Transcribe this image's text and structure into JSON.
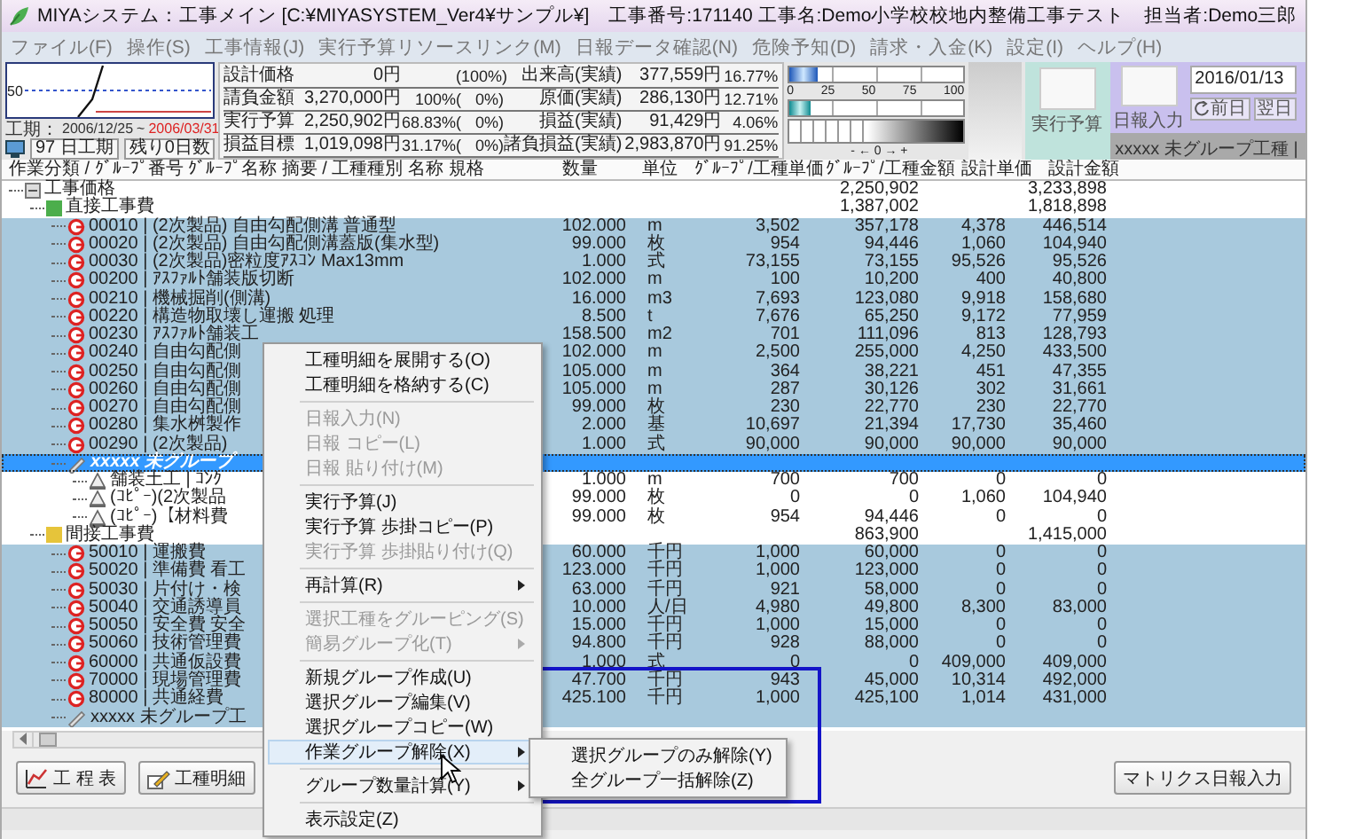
{
  "window": {
    "title": "MIYAシステム：工事メイン [C:¥MIYASYSTEM_Ver4¥サンプル¥]　工事番号:171140 工事名:Demo小学校校地内整備工事テスト　担当者:Demo三郎"
  },
  "menu": [
    "ファイル(F)",
    "操作(S)",
    "工事情報(J)",
    "実行予算リソースリンク(M)",
    "日報データ確認(N)",
    "危険予知(D)",
    "請求・入金(K)",
    "設定(I)",
    "ヘルプ(H)"
  ],
  "summary": {
    "chart_axis": "50",
    "period": {
      "label": "工期：",
      "start": "2006/12/25",
      "separator": "~",
      "end": "2006/03/31"
    },
    "days": [
      "97 日工期",
      "残り0日数"
    ],
    "rows": [
      {
        "label": "設計価格",
        "amount": "0円",
        "ratio": "(",
        "change": "100%)",
        "result_label": "出来高(実績)",
        "result_amount": "377,559円",
        "result_ratio": "16.77%"
      },
      {
        "label": "請負金額",
        "amount": "3,270,000円",
        "ratio": "100%(",
        "change": "0%)",
        "result_label": "原価(実績)",
        "result_amount": "286,130円",
        "result_ratio": "12.71%"
      },
      {
        "label": "実行予算",
        "amount": "2,250,902円",
        "ratio": "68.83%(",
        "change": "0%)",
        "result_label": "損益(実績)",
        "result_amount": "91,429円",
        "result_ratio": "4.06%"
      },
      {
        "label": "損益目標",
        "amount": "1,019,098円",
        "ratio": "31.17%(",
        "change": "0%)",
        "result_label": "諸負損益(実績)",
        "result_amount": "2,983,870円",
        "result_ratio": "91.25%"
      }
    ],
    "bars": [
      {
        "level": 0.17
      },
      {
        "level": 0.13
      }
    ],
    "scale": [
      "0",
      "25",
      "50",
      "75",
      "100"
    ],
    "balance_label": "- ← 0 → +",
    "budget_button": "実行予算",
    "report_button": "日報入力",
    "date": "2016/01/13",
    "prev_button": "前日",
    "next_button": "翌日",
    "group_label": "xxxxx 未グループ工種 |"
  },
  "table": {
    "columns": [
      "作業分類 / ｸﾞﾙｰﾌﾟ番号 ｸﾞﾙｰﾌﾟ名称 摘要 / 工種種別 名称 規格",
      "数量",
      "単位",
      "ｸﾞﾙｰﾌﾟ/工種単価",
      "ｸﾞﾙｰﾌﾟ/工種金額",
      "設計単価",
      "設計金額"
    ]
  },
  "tree": [
    {
      "kind": "root",
      "label": "工事価格",
      "amount": "2,250,902",
      "design_amount": "3,233,898",
      "selected": false,
      "focused": false,
      "children": [
        {
          "kind": "category",
          "color": "#4cae4c",
          "label": "直接工事費",
          "amount": "1,387,002",
          "design_amount": "1,818,898",
          "selected": false,
          "focused": false,
          "children": [
            {
              "kind": "group",
              "label": "00010 | (2次製品) 自由勾配側溝 普通型",
              "qty": "102.000",
              "unit": "m",
              "unit_price": "3,502",
              "amount": "357,178",
              "design_unit_price": "4,378",
              "design_amount": "446,514",
              "selected": true,
              "focused": false
            },
            {
              "kind": "group",
              "label": "00020 | (2次製品) 自由勾配側溝蓋版(集水型)",
              "qty": "99.000",
              "unit": "枚",
              "unit_price": "954",
              "amount": "94,446",
              "design_unit_price": "1,060",
              "design_amount": "104,940",
              "selected": true,
              "focused": false
            },
            {
              "kind": "group",
              "label": "00030 | (2次製品)密粒度ｱｽｺﾝ Max13mm",
              "qty": "1.000",
              "unit": "式",
              "unit_price": "73,155",
              "amount": "73,155",
              "design_unit_price": "95,526",
              "design_amount": "95,526",
              "selected": true,
              "focused": false
            },
            {
              "kind": "group",
              "label": "00200 | ｱｽﾌｧﾙﾄ舗装版切断",
              "qty": "102.000",
              "unit": "m",
              "unit_price": "100",
              "amount": "10,200",
              "design_unit_price": "400",
              "design_amount": "40,800",
              "selected": true,
              "focused": false
            },
            {
              "kind": "group",
              "label": "00210 | 機械掘削(側溝)",
              "qty": "16.000",
              "unit": "m3",
              "unit_price": "7,693",
              "amount": "123,080",
              "design_unit_price": "9,918",
              "design_amount": "158,680",
              "selected": true,
              "focused": false
            },
            {
              "kind": "group",
              "label": "00220 | 構造物取壊し運搬 処理",
              "qty": "8.500",
              "unit": "t",
              "unit_price": "7,676",
              "amount": "65,250",
              "design_unit_price": "9,172",
              "design_amount": "77,959",
              "selected": true,
              "focused": false
            },
            {
              "kind": "group",
              "label": "00230 | ｱｽﾌｧﾙﾄ舗装工",
              "qty": "158.500",
              "unit": "m2",
              "unit_price": "701",
              "amount": "111,096",
              "design_unit_price": "813",
              "design_amount": "128,793",
              "selected": true,
              "focused": false
            },
            {
              "kind": "group",
              "label": "00240 | 自由勾配側",
              "qty": "102.000",
              "unit": "m",
              "unit_price": "2,500",
              "amount": "255,000",
              "design_unit_price": "4,250",
              "design_amount": "433,500",
              "selected": true,
              "focused": false
            },
            {
              "kind": "group",
              "label": "00250 | 自由勾配側",
              "qty": "105.000",
              "unit": "m",
              "unit_price": "364",
              "amount": "38,221",
              "design_unit_price": "451",
              "design_amount": "47,355",
              "selected": true,
              "focused": false
            },
            {
              "kind": "group",
              "label": "00260 | 自由勾配側",
              "qty": "105.000",
              "unit": "m",
              "unit_price": "287",
              "amount": "30,126",
              "design_unit_price": "302",
              "design_amount": "31,661",
              "selected": true,
              "focused": false
            },
            {
              "kind": "group",
              "label": "00270 | 自由勾配側",
              "qty": "99.000",
              "unit": "枚",
              "unit_price": "230",
              "amount": "22,770",
              "design_unit_price": "230",
              "design_amount": "22,770",
              "selected": true,
              "focused": false
            },
            {
              "kind": "group",
              "label": "00280 | 集水桝製作",
              "qty": "2.000",
              "unit": "基",
              "unit_price": "10,697",
              "amount": "21,394",
              "design_unit_price": "17,730",
              "design_amount": "35,460",
              "selected": true,
              "focused": false
            },
            {
              "kind": "group",
              "label": "00290 | (2次製品)",
              "qty": "1.000",
              "unit": "式",
              "unit_price": "90,000",
              "amount": "90,000",
              "design_unit_price": "90,000",
              "design_amount": "90,000",
              "selected": true,
              "focused": false
            },
            {
              "kind": "ungrouped",
              "label": "xxxxx 未グループ",
              "selected": true,
              "focused": true,
              "children": [
                {
                  "kind": "item",
                  "label": "舗装土工 | ｺﾝｸ",
                  "qty": "1.000",
                  "unit": "m",
                  "unit_price": "700",
                  "amount": "700",
                  "design_unit_price": "0",
                  "design_amount": "0",
                  "selected": false,
                  "focused": false
                },
                {
                  "kind": "item",
                  "label": "(ｺﾋﾟｰ)(2次製品",
                  "qty": "99.000",
                  "unit": "枚",
                  "unit_price": "0",
                  "amount": "0",
                  "design_unit_price": "1,060",
                  "design_amount": "104,940",
                  "selected": false,
                  "focused": false
                },
                {
                  "kind": "item",
                  "label": "(ｺﾋﾟｰ)【材料費",
                  "qty": "99.000",
                  "unit": "枚",
                  "unit_price": "954",
                  "amount": "94,446",
                  "design_unit_price": "0",
                  "design_amount": "0",
                  "selected": false,
                  "focused": false
                }
              ]
            }
          ]
        },
        {
          "kind": "category",
          "color": "#e6c43a",
          "label": "間接工事費",
          "amount": "863,900",
          "design_amount": "1,415,000",
          "selected": false,
          "focused": false,
          "children": [
            {
              "kind": "group",
              "label": "50010 | 運搬費",
              "qty": "60.000",
              "unit": "千円",
              "unit_price": "1,000",
              "amount": "60,000",
              "design_unit_price": "0",
              "design_amount": "0",
              "selected": true,
              "focused": false
            },
            {
              "kind": "group",
              "label": "50020 | 準備費 看工",
              "qty": "123.000",
              "unit": "千円",
              "unit_price": "1,000",
              "amount": "123,000",
              "design_unit_price": "0",
              "design_amount": "0",
              "selected": true,
              "focused": false
            },
            {
              "kind": "group",
              "label": "50030 | 片付け・検",
              "qty": "63.000",
              "unit": "千円",
              "unit_price": "921",
              "amount": "58,000",
              "design_unit_price": "0",
              "design_amount": "0",
              "selected": true,
              "focused": false
            },
            {
              "kind": "group",
              "label": "50040 | 交通誘導員",
              "qty": "10.000",
              "unit": "人/日",
              "unit_price": "4,980",
              "amount": "49,800",
              "design_unit_price": "8,300",
              "design_amount": "83,000",
              "selected": true,
              "focused": false
            },
            {
              "kind": "group",
              "label": "50050 | 安全費 安全",
              "qty": "15.000",
              "unit": "千円",
              "unit_price": "1,000",
              "amount": "15,000",
              "design_unit_price": "0",
              "design_amount": "0",
              "selected": true,
              "focused": false
            },
            {
              "kind": "group",
              "label": "50060 | 技術管理費",
              "qty": "94.800",
              "unit": "千円",
              "unit_price": "928",
              "amount": "88,000",
              "design_unit_price": "0",
              "design_amount": "0",
              "selected": true,
              "focused": false
            },
            {
              "kind": "group",
              "label": "60000 | 共通仮設費",
              "qty": "1.000",
              "unit": "式",
              "unit_price": "0",
              "amount": "0",
              "design_unit_price": "409,000",
              "design_amount": "409,000",
              "selected": true,
              "focused": false
            },
            {
              "kind": "group",
              "label": "70000 | 現場管理費",
              "qty": "47.700",
              "unit": "千円",
              "unit_price": "943",
              "amount": "45,000",
              "design_unit_price": "10,314",
              "design_amount": "492,000",
              "selected": true,
              "focused": false
            },
            {
              "kind": "group",
              "label": "80000 | 共通経費",
              "qty": "425.100",
              "unit": "千円",
              "unit_price": "1,000",
              "amount": "425,100",
              "design_unit_price": "1,014",
              "design_amount": "431,000",
              "selected": true,
              "focused": false
            },
            {
              "kind": "ungrouped",
              "label": "xxxxx 未グループ工",
              "selected": true,
              "focused": false
            }
          ]
        }
      ]
    }
  ],
  "context_menu": [
    {
      "kind": "item",
      "label": "工種明細を展開する(O)",
      "disabled": false,
      "submenu": false,
      "selected": false
    },
    {
      "kind": "item",
      "label": "工種明細を格納する(C)",
      "disabled": false,
      "submenu": false,
      "selected": false
    },
    {
      "kind": "separator"
    },
    {
      "kind": "item",
      "label": "日報入力(N)",
      "disabled": true,
      "submenu": false,
      "selected": false
    },
    {
      "kind": "item",
      "label": "日報 コピー(L)",
      "disabled": true,
      "submenu": false,
      "selected": false
    },
    {
      "kind": "item",
      "label": "日報 貼り付け(M)",
      "disabled": true,
      "submenu": false,
      "selected": false
    },
    {
      "kind": "separator"
    },
    {
      "kind": "item",
      "label": "実行予算(J)",
      "disabled": false,
      "submenu": false,
      "selected": false
    },
    {
      "kind": "item",
      "label": "実行予算 歩掛コピー(P)",
      "disabled": false,
      "submenu": false,
      "selected": false
    },
    {
      "kind": "item",
      "label": "実行予算 歩掛貼り付け(Q)",
      "disabled": true,
      "submenu": false,
      "selected": false
    },
    {
      "kind": "separator"
    },
    {
      "kind": "item",
      "label": "再計算(R)",
      "disabled": false,
      "submenu": true,
      "selected": false
    },
    {
      "kind": "separator"
    },
    {
      "kind": "item",
      "label": "選択工種をグルーピング(S)",
      "disabled": true,
      "submenu": false,
      "selected": false
    },
    {
      "kind": "item",
      "label": "簡易グループ化(T)",
      "disabled": true,
      "submenu": true,
      "selected": false
    },
    {
      "kind": "separator"
    },
    {
      "kind": "item",
      "label": "新規グループ作成(U)",
      "disabled": false,
      "submenu": false,
      "selected": false
    },
    {
      "kind": "item",
      "label": "選択グループ編集(V)",
      "disabled": false,
      "submenu": false,
      "selected": false
    },
    {
      "kind": "item",
      "label": "選択グループコピー(W)",
      "disabled": false,
      "submenu": false,
      "selected": false
    },
    {
      "kind": "item",
      "label": "作業グループ解除(X)",
      "disabled": false,
      "submenu": true,
      "selected": true
    },
    {
      "kind": "separator"
    },
    {
      "kind": "item",
      "label": "グループ数量計算(Y)",
      "disabled": false,
      "submenu": true,
      "selected": false
    },
    {
      "kind": "separator"
    },
    {
      "kind": "item",
      "label": "表示設定(Z)",
      "disabled": false,
      "submenu": false,
      "selected": false
    }
  ],
  "submenu": [
    "選択グループのみ解除(Y)",
    "全グループ一括解除(Z)"
  ],
  "toolbar": {
    "left_buttons": [
      "工 程 表",
      "工種明細"
    ],
    "right_buttons": [
      "マトリクス日報入力"
    ]
  }
}
